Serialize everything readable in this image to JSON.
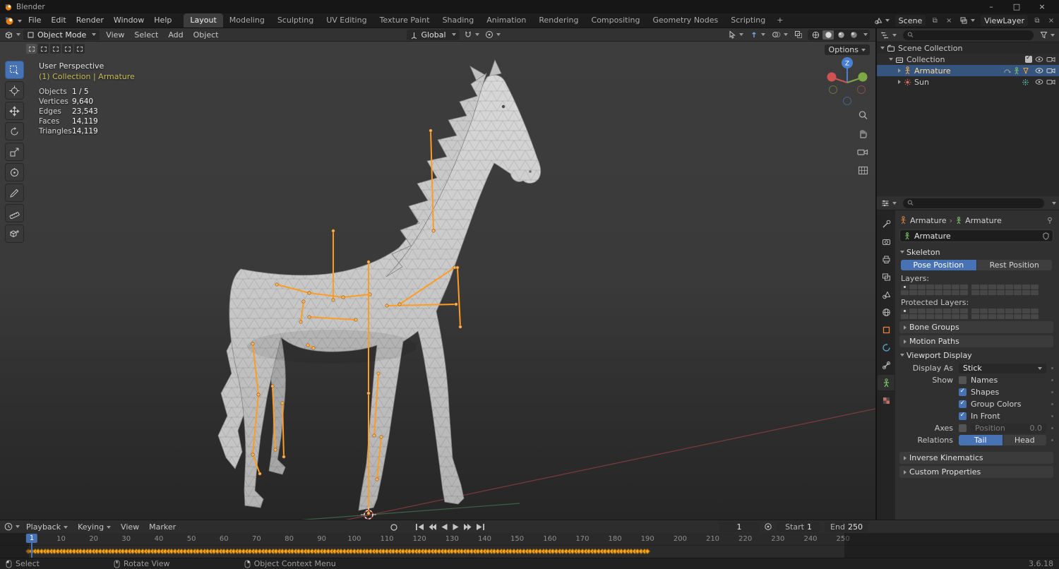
{
  "app": {
    "title": "Blender",
    "version": "3.6.18"
  },
  "window_controls": {
    "minimize": "–",
    "maximize": "□",
    "close": "×"
  },
  "topbar": {
    "menus": [
      "File",
      "Edit",
      "Render",
      "Window",
      "Help"
    ],
    "workspaces": [
      "Layout",
      "Modeling",
      "Sculpting",
      "UV Editing",
      "Texture Paint",
      "Shading",
      "Animation",
      "Rendering",
      "Compositing",
      "Geometry Nodes",
      "Scripting"
    ],
    "active_workspace": "Layout",
    "add_tab": "+",
    "scene": {
      "value": "Scene"
    },
    "view_layer": {
      "value": "ViewLayer"
    }
  },
  "viewport": {
    "header": {
      "mode": "Object Mode",
      "menus": [
        "View",
        "Select",
        "Add",
        "Object"
      ],
      "orientation": "Global",
      "options_button": "Options"
    },
    "overlay": {
      "perspective": "User Perspective",
      "context": "(1) Collection | Armature",
      "stats": [
        {
          "label": "Objects",
          "value": "1 / 5"
        },
        {
          "label": "Vertices",
          "value": "9,640"
        },
        {
          "label": "Edges",
          "value": "23,543"
        },
        {
          "label": "Faces",
          "value": "14,119"
        },
        {
          "label": "Triangles",
          "value": "14,119"
        }
      ]
    },
    "gizmo": {
      "z_label": "Z"
    },
    "tools": [
      "select-box",
      "cursor",
      "move",
      "rotate",
      "scale",
      "transform",
      "annotate",
      "measure",
      "add-cube"
    ],
    "active_tool": "select-box"
  },
  "outliner": {
    "rows": [
      {
        "label": "Scene Collection"
      },
      {
        "label": "Collection"
      },
      {
        "label": "Armature",
        "selected": true,
        "active": true
      },
      {
        "label": "Sun"
      }
    ]
  },
  "properties": {
    "breadcrumb": {
      "object": "Armature",
      "data": "Armature"
    },
    "name_field": "Armature",
    "tabs": [
      "tool",
      "render",
      "output",
      "view-layer",
      "scene",
      "world",
      "object",
      "physics",
      "constraints",
      "object-data",
      "texture"
    ],
    "active_tab": "object-data",
    "skeleton": {
      "title": "Skeleton",
      "pose_button": "Pose Position",
      "rest_button": "Rest Position",
      "active_position": "Pose Position",
      "layers_label": "Layers:",
      "protected_layers_label": "Protected Layers:",
      "layer_groups": 2,
      "layer_cols": 8,
      "layer_rows": 2,
      "active_layer_index": 0
    },
    "sections": {
      "bone_groups": "Bone Groups",
      "motion_paths": "Motion Paths",
      "viewport_display": "Viewport Display",
      "inverse_kinematics": "Inverse Kinematics",
      "custom_properties": "Custom Properties"
    },
    "viewport_display": {
      "display_as_label": "Display As",
      "display_as_value": "Stick",
      "show_label": "Show",
      "checkboxes": [
        {
          "label": "Names",
          "checked": false
        },
        {
          "label": "Shapes",
          "checked": true
        },
        {
          "label": "Group Colors",
          "checked": true
        },
        {
          "label": "In Front",
          "checked": true
        }
      ],
      "axes_label": "Axes",
      "axes_checked": false,
      "position_label": "Position",
      "position_value": "0.0",
      "relations_label": "Relations",
      "tail_button": "Tail",
      "head_button": "Head",
      "active_relation": "Tail"
    }
  },
  "timeline": {
    "menus": [
      "Playback",
      "Keying",
      "View",
      "Marker"
    ],
    "current_frame": "1",
    "start_label": "Start",
    "start_value": "1",
    "end_label": "End",
    "end_value": "250",
    "ruler_ticks": [
      10,
      20,
      30,
      40,
      50,
      60,
      70,
      80,
      90,
      100,
      110,
      120,
      130,
      140,
      150,
      160,
      170,
      180,
      190,
      200,
      210,
      220,
      230,
      240,
      250
    ],
    "keyframes": {
      "first": 0,
      "last": 190,
      "step": 1
    }
  },
  "statusbar": {
    "hints": [
      {
        "button": "left",
        "label": "Select"
      },
      {
        "button": "middle",
        "label": "Rotate View"
      },
      {
        "button": "right",
        "label": "Object Context Menu"
      }
    ],
    "version": "3.6.18"
  },
  "colors": {
    "accent_blue": "#4772b3",
    "bone_orange": "#ff9d23",
    "keyframe_orange": "#f5a623",
    "context_yellow": "#cbbd58",
    "selected_row_blue": "#36557e"
  }
}
